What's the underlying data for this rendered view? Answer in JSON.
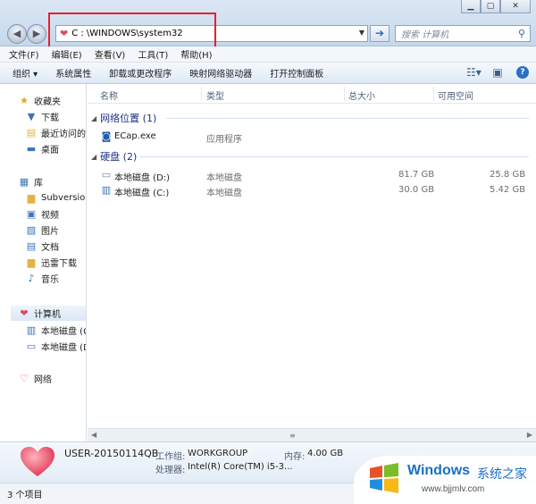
{
  "window": {
    "controls": {
      "minimize": "▁",
      "maximize": "▢",
      "close": "✕"
    }
  },
  "address": {
    "path": "C : \\WINDOWS\\system32",
    "icon": "heart-computer-icon"
  },
  "search": {
    "placeholder": "搜索 计算机"
  },
  "menu": [
    "文件(F)",
    "编辑(E)",
    "查看(V)",
    "工具(T)",
    "帮助(H)"
  ],
  "toolbar": {
    "organize": "组织 ▾",
    "items": [
      "系统属性",
      "卸载或更改程序",
      "映射网络驱动器",
      "打开控制面板"
    ]
  },
  "nav": {
    "favorites": {
      "label": "收藏夹",
      "items": [
        "下载",
        "最近访问的",
        "桌面"
      ]
    },
    "libraries": {
      "label": "库",
      "items": [
        "Subversion",
        "视频",
        "图片",
        "文档",
        "迅雷下载",
        "音乐"
      ]
    },
    "computer": {
      "label": "计算机",
      "items": [
        "本地磁盘 (C",
        "本地磁盘 (D"
      ]
    },
    "network": {
      "label": "网络"
    }
  },
  "columns": {
    "name": "名称",
    "type": "类型",
    "total": "总大小",
    "free": "可用空间"
  },
  "groups": {
    "network": {
      "label": "网络位置 (1)",
      "rows": [
        {
          "name": "ECap.exe",
          "type": "应用程序"
        }
      ]
    },
    "disks": {
      "label": "硬盘 (2)",
      "rows": [
        {
          "name": "本地磁盘 (D:)",
          "type": "本地磁盘",
          "total": "81.7 GB",
          "free": "25.8 GB"
        },
        {
          "name": "本地磁盘 (C:)",
          "type": "本地磁盘",
          "total": "30.0 GB",
          "free": "5.42 GB"
        }
      ]
    }
  },
  "details": {
    "computer_name": "USER-20150114QB",
    "workgroup_label": "工作组:",
    "workgroup": "WORKGROUP",
    "memory_label": "内存:",
    "memory": "4.00 GB",
    "cpu_label": "处理器:",
    "cpu": "Intel(R) Core(TM) i5-3..."
  },
  "status": {
    "count": "3 个项目"
  },
  "watermark": {
    "brand": "Windows",
    "cn": "系统之家",
    "url": "www.bjjmlv.com"
  },
  "colors": {
    "accent": "#2d6ec5",
    "highlight_box": "#e8202a",
    "heart": "#e04860",
    "group_text": "#1e3287"
  }
}
